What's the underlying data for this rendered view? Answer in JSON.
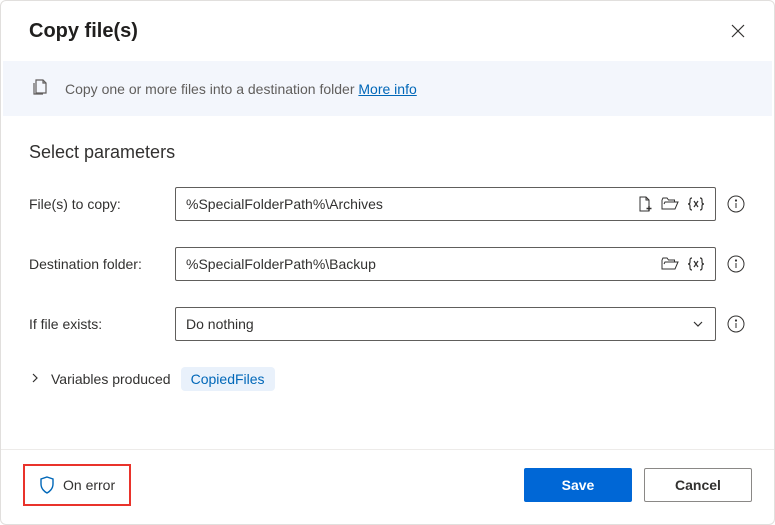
{
  "header": {
    "title": "Copy file(s)"
  },
  "banner": {
    "text": "Copy one or more files into a destination folder",
    "link": "More info"
  },
  "section": {
    "title": "Select parameters"
  },
  "fields": {
    "files_to_copy": {
      "label": "File(s) to copy:",
      "value": "%SpecialFolderPath%\\Archives"
    },
    "destination_folder": {
      "label": "Destination folder:",
      "value": "%SpecialFolderPath%\\Backup"
    },
    "if_file_exists": {
      "label": "If file exists:",
      "value": "Do nothing"
    }
  },
  "variables": {
    "label": "Variables produced",
    "chip": "CopiedFiles"
  },
  "footer": {
    "on_error": "On error",
    "save": "Save",
    "cancel": "Cancel"
  }
}
